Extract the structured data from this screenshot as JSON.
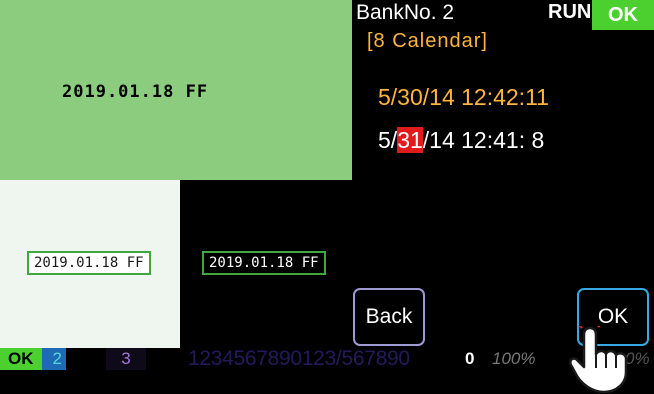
{
  "left_panel": {
    "date_glyph_text": "2019.01.18 FF",
    "date_left": "2019.01.18 FF",
    "date_right": "2019.01.18 FF"
  },
  "header": {
    "bank": "BankNo. 2",
    "mode": "[8 Calendar]",
    "run": "RUN",
    "ok_badge": "OK"
  },
  "times": {
    "line1": "5/30/14 12:42:11",
    "line2_prefix": "5/",
    "line2_highlight": "31",
    "line2_suffix": "/14 12:41: 8"
  },
  "buttons": {
    "back": "Back",
    "ok": "OK"
  },
  "status_bar": {
    "ok": "OK",
    "num2": "2",
    "num3": "3",
    "digits": "1234567890123/567890",
    "zero": "0",
    "percent": "100%",
    "zero_percent": "0%"
  },
  "colors": {
    "green_panel": "#8ccc7e",
    "orange": "#ffb43c",
    "ok_green": "#4bd02f",
    "highlight_red": "#e11b1b",
    "ok_button_border": "#36a9e3"
  },
  "icons": {
    "pointer": "hand-pointer-icon"
  }
}
